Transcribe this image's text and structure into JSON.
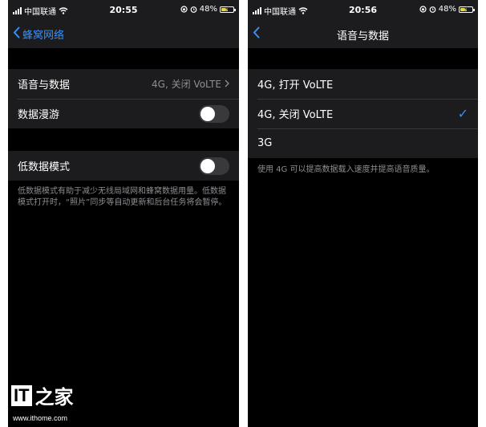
{
  "left_screen": {
    "status": {
      "carrier": "中国联通",
      "time": "20:55",
      "battery": "48%"
    },
    "nav": {
      "back_label": "蜂窝网络"
    },
    "rows": {
      "voice_data_label": "语音与数据",
      "voice_data_value": "4G, 关闭 VoLTE",
      "roaming_label": "数据漫游",
      "low_data_label": "低数据模式"
    },
    "toggles": {
      "roaming_on": false,
      "low_data_on": false
    },
    "low_data_footnote": "低数据模式有助于减少无线局域网和蜂窝数据用量。低数据模式打开时，“照片”同步等自动更新和后台任务将会暂停。"
  },
  "right_screen": {
    "status": {
      "carrier": "中国联通",
      "time": "20:56",
      "battery": "48%"
    },
    "nav": {
      "title": "语音与数据"
    },
    "options": [
      {
        "label": "4G, 打开 VoLTE",
        "selected": false
      },
      {
        "label": "4G, 关闭 VoLTE",
        "selected": true
      },
      {
        "label": "3G",
        "selected": false
      }
    ],
    "footnote": "使用 4G 可以提高数据载入速度并提高语音质量。"
  },
  "watermark": {
    "logo_text": "IT之家",
    "site": "www.ithome.com"
  },
  "colors": {
    "accent": "#3a8ff5",
    "cell_bg": "#1c1c1e",
    "bg": "#000000",
    "secondary_text": "#8e8e93",
    "battery": "#e6d64a"
  },
  "icons": [
    "signal-icon",
    "wifi-icon",
    "alarm-icon",
    "lock-rotation-icon",
    "battery-icon",
    "chevron-left-icon",
    "chevron-right-icon",
    "checkmark-icon"
  ]
}
